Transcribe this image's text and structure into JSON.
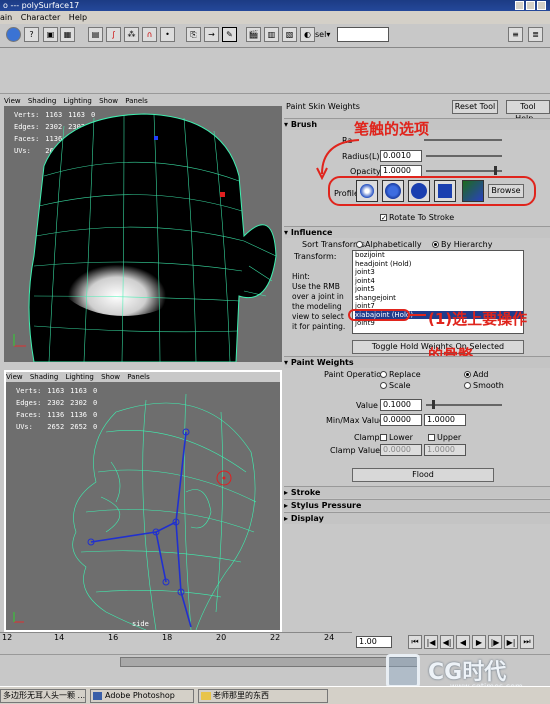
{
  "window": {
    "title": "polySurface17",
    "title_prefix": "o  ---"
  },
  "menu": [
    "ain",
    "Character",
    "Help"
  ],
  "toolbar": {
    "sel_label": "sel▾"
  },
  "viewport_top": {
    "menu": [
      "View",
      "Shading",
      "Lighting",
      "Show",
      "Panels"
    ],
    "stats": [
      {
        "label": "Verts:",
        "a": "1163",
        "b": "1163",
        "c": "0"
      },
      {
        "label": "Edges:",
        "a": "2302",
        "b": "2302",
        "c": "0"
      },
      {
        "label": "Faces:",
        "a": "1136",
        "b": "1136",
        "c": "0"
      },
      {
        "label": "UVs:",
        "a": "2652",
        "b": "2652",
        "c": "0"
      }
    ]
  },
  "viewport_bottom": {
    "menu": [
      "View",
      "Shading",
      "Lighting",
      "Show",
      "Panels"
    ],
    "stats": [
      {
        "label": "Verts:",
        "a": "1163",
        "b": "1163",
        "c": "0"
      },
      {
        "label": "Edges:",
        "a": "2302",
        "b": "2302",
        "c": "0"
      },
      {
        "label": "Faces:",
        "a": "1136",
        "b": "1136",
        "c": "0"
      },
      {
        "label": "UVs:",
        "a": "2652",
        "b": "2652",
        "c": "0"
      }
    ],
    "camera_label": "side"
  },
  "panel": {
    "title": "Paint Skin Weights",
    "reset_tool": "Reset Tool",
    "tool_help": "Tool Help...",
    "brush": {
      "header": "Brush",
      "radius_u_label": "Ra",
      "radius_l_label": "Radius(L)",
      "radius_l_value": "0.0010",
      "opacity_label": "Opacity",
      "opacity_value": "1.0000",
      "profile_label": "Profile",
      "browse": "Browse",
      "rotate_to_stroke": "Rotate To Stroke",
      "annotation": "笔触的选项"
    },
    "influence": {
      "header": "Influence",
      "sort_label": "Sort Transforms",
      "sort_alpha": "Alphabetically",
      "sort_hier": "By Hierarchy",
      "transform_label": "Transform:",
      "joints": [
        "bozijoint",
        "headjoint (Hold)",
        "joint3",
        "joint4",
        "joint5",
        "shangejoint",
        "joint7",
        "xiabajoint (Hold)",
        "joint9"
      ],
      "selected_index": 7,
      "hint": [
        "Hint:",
        "Use the RMB",
        "over a joint in",
        "the modeling",
        "view to select",
        "it for painting."
      ],
      "toggle_hold": "Toggle Hold Weights On Selected",
      "annotation_1": "(1)选上要操作",
      "annotation_2": "的骨骼"
    },
    "paint_weights": {
      "header": "Paint Weights",
      "operation_label": "Paint Operation",
      "ops": [
        "Replace",
        "Add",
        "Scale",
        "Smooth"
      ],
      "value_label": "Value",
      "value": "0.1000",
      "minmax_label": "Min/Max Value",
      "min": "0.0000",
      "max": "1.0000",
      "clamp_label": "Clamp",
      "clamp_lower": "Lower",
      "clamp_upper": "Upper",
      "clamp_values_label": "Clamp Values",
      "clamp_v1": "0.0000",
      "clamp_v2": "1.0000",
      "flood": "Flood"
    },
    "stroke": {
      "header": "Stroke"
    },
    "stylus": {
      "header": "Stylus Pressure"
    },
    "display": {
      "header": "Display"
    }
  },
  "timeline": {
    "ticks": [
      "12",
      "14",
      "16",
      "18",
      "20",
      "22",
      "24"
    ],
    "current": "1.00"
  },
  "taskbar": {
    "items": [
      "多边形无耳人头一颗 ...",
      "Adobe Photoshop",
      "老师那里的东西"
    ]
  },
  "watermark": {
    "brand": "CG时代",
    "url": "www.cgtimes.com"
  },
  "colors": {
    "annotation_red": "#e0241c",
    "wire_green": "#3ef0b0",
    "joint_blue": "#2030d0"
  }
}
